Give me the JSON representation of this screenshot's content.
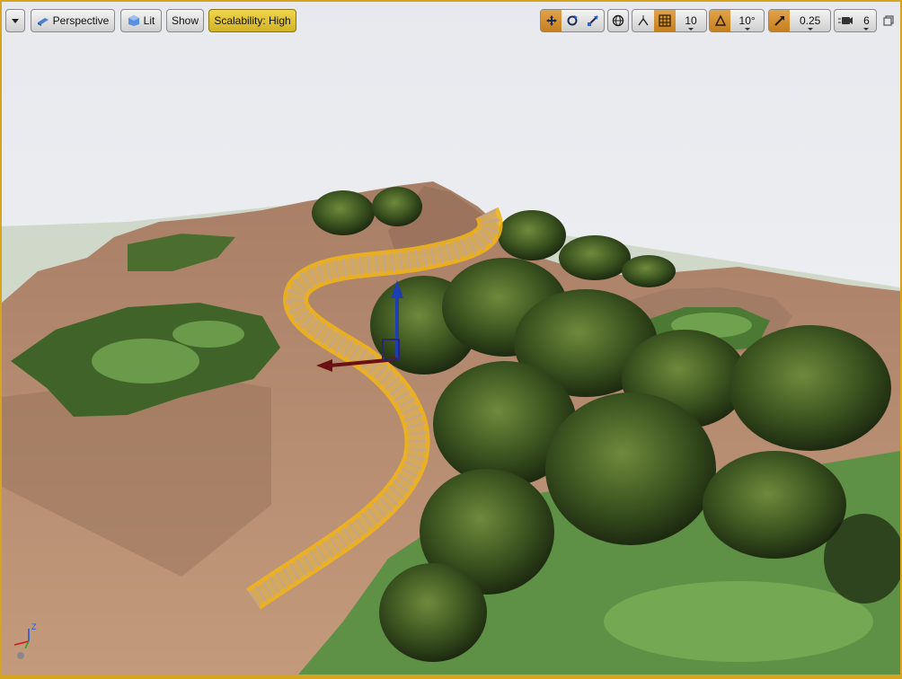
{
  "toolbar": {
    "options_icon": "chevron-down-icon",
    "perspective": {
      "label": "Perspective",
      "icon": "perspective-cube-icon"
    },
    "lit": {
      "label": "Lit",
      "icon": "lit-sphere-icon"
    },
    "show": {
      "label": "Show"
    },
    "scalability": {
      "label": "Scalability: High"
    },
    "transform_tools": [
      "translate-icon",
      "rotate-icon",
      "scale-icon"
    ],
    "world_local_icon": "globe-icon",
    "surface_snap_icon": "surface-snap-icon",
    "grid_snap": {
      "icon": "grid-snap-icon",
      "value": "10"
    },
    "rotation_snap": {
      "icon": "angle-snap-icon",
      "value": "10°"
    },
    "scale_snap": {
      "icon": "scale-snap-icon",
      "value": "0.25"
    },
    "camera_speed": {
      "icon": "camera-speed-icon",
      "value": "6"
    },
    "maximize_icon": "maximize-icon"
  },
  "axis_indicator": {
    "x_color": "#d01818",
    "y_color": "#2ea12e",
    "z_color": "#2a5bd8",
    "z_label": "Z"
  },
  "colors": {
    "highlight": "#d6a520",
    "spline": "#f0b41a",
    "terrain": "#b48769",
    "sky": "#e9eaee"
  }
}
